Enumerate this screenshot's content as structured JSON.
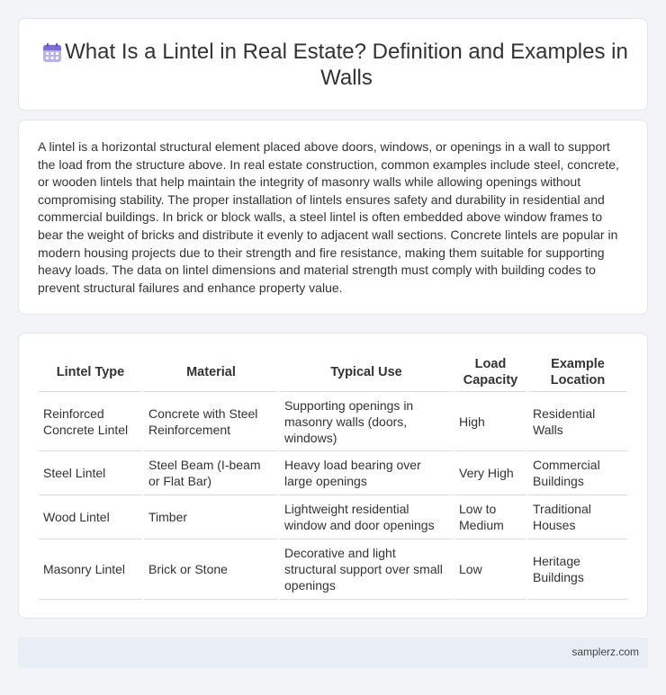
{
  "header": {
    "title": "What Is a Lintel in Real Estate? Definition and Examples in Walls",
    "icon": "calendar-icon",
    "icon_color": "#7b6fd6"
  },
  "description": "A lintel is a horizontal structural element placed above doors, windows, or openings in a wall to support the load from the structure above. In real estate construction, common examples include steel, concrete, or wooden lintels that help maintain the integrity of masonry walls while allowing openings without compromising stability. The proper installation of lintels ensures safety and durability in residential and commercial buildings. In brick or block walls, a steel lintel is often embedded above window frames to bear the weight of bricks and distribute it evenly to adjacent wall sections. Concrete lintels are popular in modern housing projects due to their strength and fire resistance, making them suitable for supporting heavy loads. The data on lintel dimensions and material strength must comply with building codes to prevent structural failures and enhance property value.",
  "table": {
    "headers": [
      "Lintel Type",
      "Material",
      "Typical Use",
      "Load Capacity",
      "Example Location"
    ],
    "rows": [
      [
        "Reinforced Concrete Lintel",
        "Concrete with Steel Reinforcement",
        "Supporting openings in masonry walls (doors, windows)",
        "High",
        "Residential Walls"
      ],
      [
        "Steel Lintel",
        "Steel Beam (I-beam or Flat Bar)",
        "Heavy load bearing over large openings",
        "Very High",
        "Commercial Buildings"
      ],
      [
        "Wood Lintel",
        "Timber",
        "Lightweight residential window and door openings",
        "Low to Medium",
        "Traditional Houses"
      ],
      [
        "Masonry Lintel",
        "Brick or Stone",
        "Decorative and light structural support over small openings",
        "Low",
        "Heritage Buildings"
      ]
    ]
  },
  "footer": {
    "site": "samplerz.com"
  }
}
